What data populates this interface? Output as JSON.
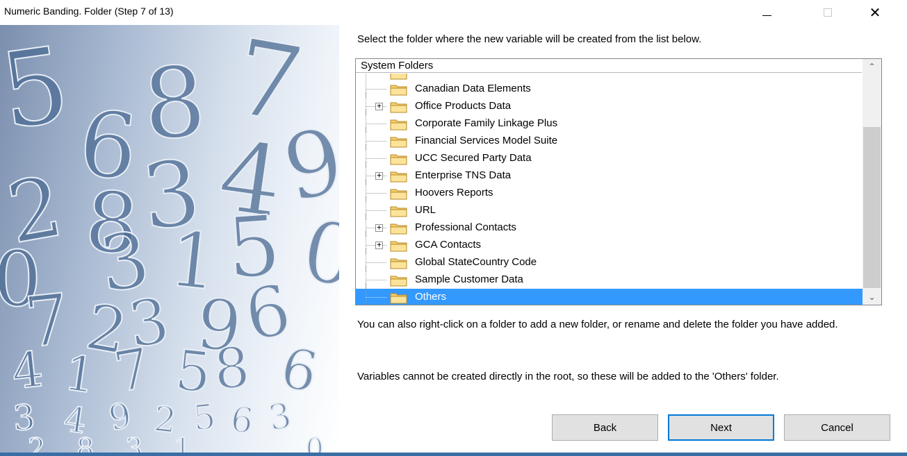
{
  "window": {
    "title": "Numeric Banding.  Folder (Step 7 of 13)",
    "minimize_icon": "minimize-icon",
    "maximize_icon": "maximize-icon",
    "close_glyph": "✕"
  },
  "side_image": {
    "description_icon": "numbers-background-image",
    "digits": [
      "5",
      "6",
      "8",
      "7",
      "2",
      "8",
      "3",
      "4",
      "9",
      "0",
      "3",
      "1",
      "5",
      "0",
      "7",
      "2",
      "3",
      "9",
      "6",
      "4",
      "1",
      "7",
      "5",
      "8",
      "6",
      "3",
      "4",
      "9",
      "2",
      "5",
      "6",
      "3",
      "2",
      "8",
      "3",
      "1",
      "0"
    ]
  },
  "instruction": "Select the folder where the new variable will be created from the list below.",
  "tree": {
    "header": "System Folders",
    "accent_selected": "#3399ff",
    "rows": [
      {
        "label": "",
        "expandable": false,
        "partial": true,
        "selected": false
      },
      {
        "label": "Canadian Data Elements",
        "expandable": false,
        "partial": false,
        "selected": false
      },
      {
        "label": "Office Products Data",
        "expandable": true,
        "partial": false,
        "selected": false
      },
      {
        "label": "Corporate Family Linkage Plus",
        "expandable": false,
        "partial": false,
        "selected": false
      },
      {
        "label": "Financial Services Model Suite",
        "expandable": false,
        "partial": false,
        "selected": false
      },
      {
        "label": "UCC Secured Party Data",
        "expandable": false,
        "partial": false,
        "selected": false
      },
      {
        "label": "Enterprise TNS Data",
        "expandable": true,
        "partial": false,
        "selected": false
      },
      {
        "label": "Hoovers Reports",
        "expandable": false,
        "partial": false,
        "selected": false
      },
      {
        "label": "URL",
        "expandable": false,
        "partial": false,
        "selected": false
      },
      {
        "label": "Professional Contacts",
        "expandable": true,
        "partial": false,
        "selected": false
      },
      {
        "label": "GCA Contacts",
        "expandable": true,
        "partial": false,
        "selected": false
      },
      {
        "label": "Global StateCountry Code",
        "expandable": false,
        "partial": false,
        "selected": false
      },
      {
        "label": "Sample Customer Data",
        "expandable": false,
        "partial": false,
        "selected": false
      },
      {
        "label": "Others",
        "expandable": false,
        "partial": false,
        "selected": true
      }
    ],
    "expander_glyph": "+",
    "scroll_up_glyph": "⌃",
    "scroll_down_glyph": "⌄"
  },
  "hints": {
    "right_click": "You can also right-click on a folder to add a new folder, or rename and delete the folder you have added.",
    "root_note": "Variables cannot be created directly in the root, so these will be added to the 'Others' folder."
  },
  "buttons": {
    "back": "Back",
    "next": "Next",
    "cancel": "Cancel"
  }
}
